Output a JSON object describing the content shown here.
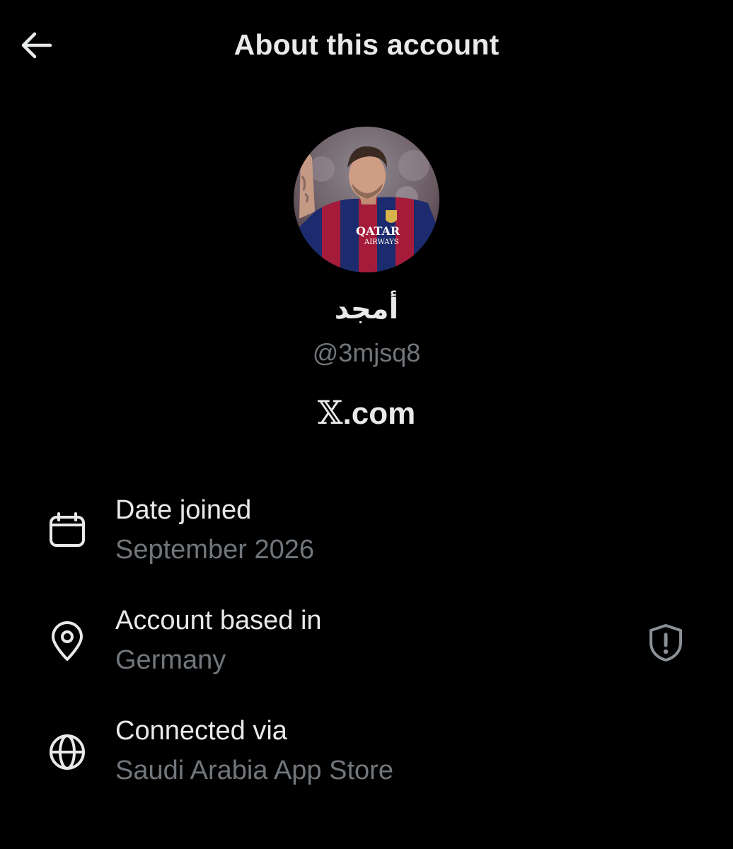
{
  "header": {
    "title": "About this account",
    "back_icon": "arrow-left-icon"
  },
  "profile": {
    "avatar_icon": "profile-photo",
    "display_name": "أمجد",
    "handle": "@3mjsq8",
    "platform_text": ".com",
    "platform_logo": "𝕏"
  },
  "details": [
    {
      "icon": "calendar-icon",
      "title": "Date joined",
      "value": "September 2026"
    },
    {
      "icon": "location-pin-icon",
      "title": "Account based in",
      "value": "Germany",
      "badge_icon": "shield-alert-icon"
    },
    {
      "icon": "globe-icon",
      "title": "Connected via",
      "value": "Saudi Arabia App Store"
    }
  ],
  "colors": {
    "background": "#000000",
    "primary_text": "#e7e9ea",
    "secondary_text": "#71767b"
  }
}
